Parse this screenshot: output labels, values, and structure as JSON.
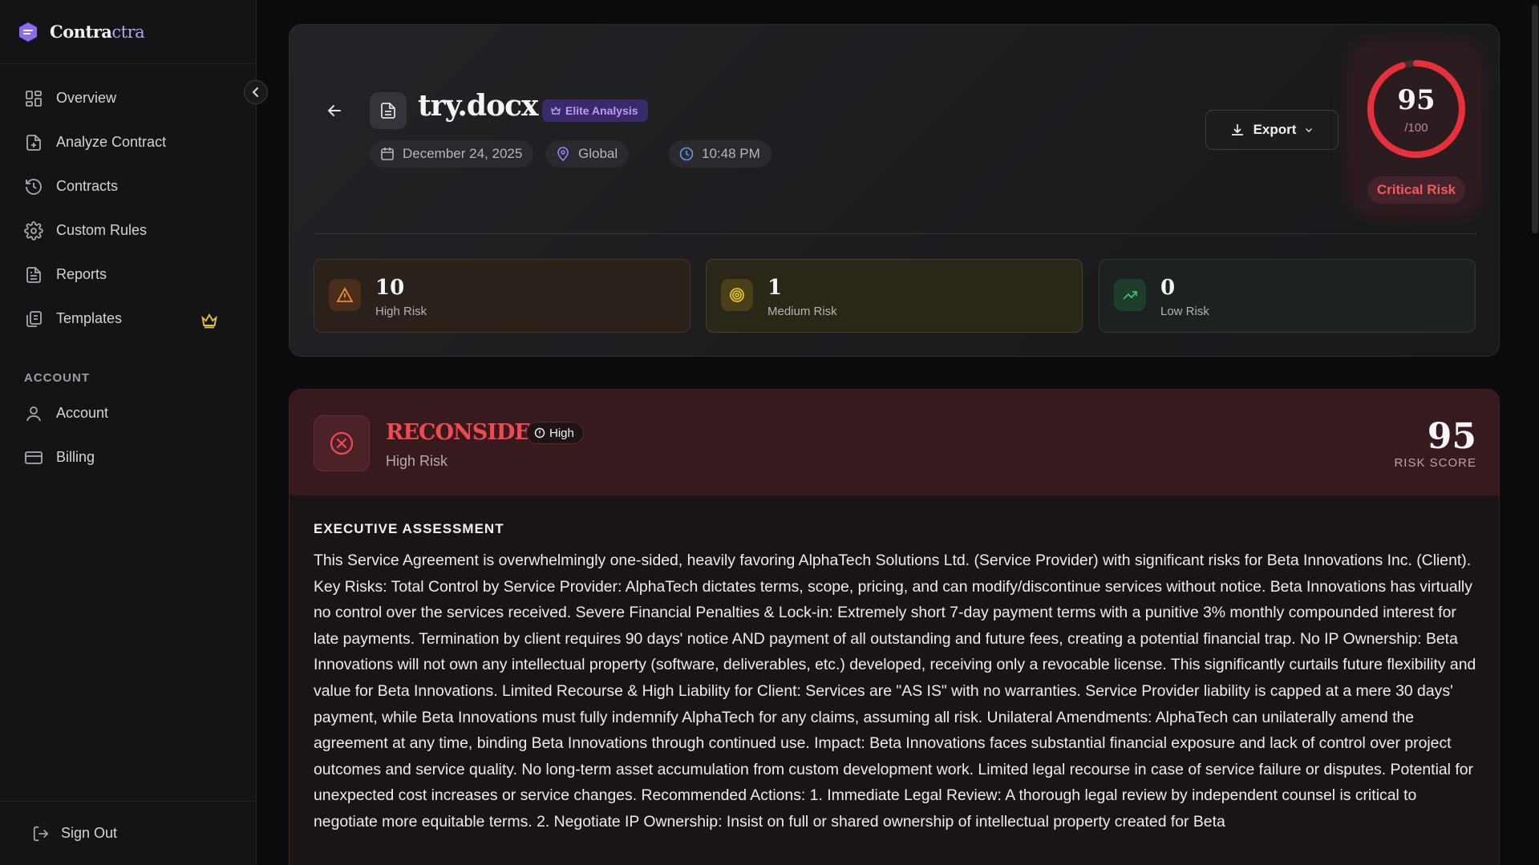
{
  "brand": {
    "name_main": "Contra",
    "name_accent": "ctra"
  },
  "sidebar": {
    "items": [
      {
        "label": "Overview",
        "icon": "grid-icon"
      },
      {
        "label": "Analyze Contract",
        "icon": "file-plus-icon"
      },
      {
        "label": "Contracts",
        "icon": "history-icon"
      },
      {
        "label": "Custom Rules",
        "icon": "gear-icon"
      },
      {
        "label": "Reports",
        "icon": "file-text-icon"
      },
      {
        "label": "Templates",
        "icon": "copy-icon",
        "badge": "crown-icon"
      }
    ],
    "account_section": "ACCOUNT",
    "account_items": [
      {
        "label": "Account",
        "icon": "user-icon"
      },
      {
        "label": "Billing",
        "icon": "credit-card-icon"
      }
    ],
    "sign_out": "Sign Out"
  },
  "document": {
    "title": "try.docx",
    "badge": "Elite Analysis",
    "date": "December 24, 2025",
    "region": "Global",
    "time": "10:48 PM",
    "export_label": "Export"
  },
  "score": {
    "value": "95",
    "denominator": "/100",
    "level": "Critical Risk",
    "fraction": 0.95
  },
  "stats": [
    {
      "count": "10",
      "label": "High Risk"
    },
    {
      "count": "1",
      "label": "Medium Risk"
    },
    {
      "count": "0",
      "label": "Low Risk"
    }
  ],
  "recommendation": {
    "verdict": "RECONSIDER",
    "severity": "High",
    "subtitle": "High Risk",
    "score": "95",
    "score_label": "RISK SCORE",
    "section_title": "EXECUTIVE ASSESSMENT",
    "assessment": "This Service Agreement is overwhelmingly one-sided, heavily favoring AlphaTech Solutions Ltd. (Service Provider) with significant risks for Beta Innovations Inc. (Client). Key Risks: Total Control by Service Provider: AlphaTech dictates terms, scope, pricing, and can modify/discontinue services without notice. Beta Innovations has virtually no control over the services received. Severe Financial Penalties & Lock-in: Extremely short 7-day payment terms with a punitive 3% monthly compounded interest for late payments. Termination by client requires 90 days' notice AND payment of all outstanding and future fees, creating a potential financial trap. No IP Ownership: Beta Innovations will not own any intellectual property (software, deliverables, etc.) developed, receiving only a revocable license. This significantly curtails future flexibility and value for Beta Innovations. Limited Recourse & High Liability for Client: Services are \"AS IS\" with no warranties. Service Provider liability is capped at a mere 30 days' payment, while Beta Innovations must fully indemnify AlphaTech for any claims, assuming all risk. Unilateral Amendments: AlphaTech can unilaterally amend the agreement at any time, binding Beta Innovations through continued use. Impact: Beta Innovations faces substantial financial exposure and lack of control over project outcomes and service quality. No long-term asset accumulation from custom development work. Limited legal recourse in case of service failure or disputes. Potential for unexpected cost increases or service changes. Recommended Actions: 1. Immediate Legal Review: A thorough legal review by independent counsel is critical to negotiate more equitable terms. 2. Negotiate IP Ownership: Insist on full or shared ownership of intellectual property created for Beta"
  },
  "colors": {
    "accent": "#8b6cf0",
    "danger": "#ef4a52",
    "high": "#e8893a",
    "medium": "#e5c02a",
    "low": "#3cbf6a"
  }
}
